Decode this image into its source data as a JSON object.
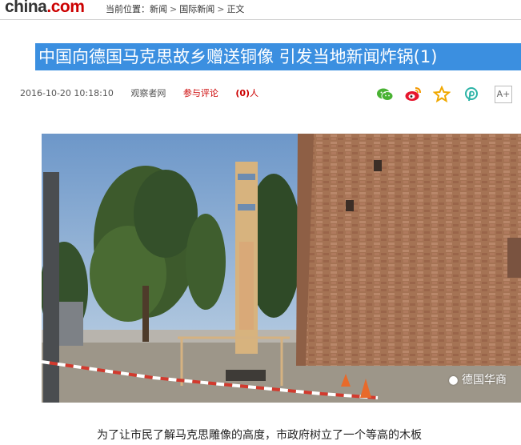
{
  "header": {
    "logo_main": "china",
    "logo_dot": ".",
    "logo_com": "com",
    "breadcrumb": {
      "label": "当前位置：",
      "items": [
        "新闻",
        "国际新闻",
        "正文"
      ]
    }
  },
  "article": {
    "title": "中国向德国马克思故乡赠送铜像 引发当地新闻炸锅(1)",
    "date": "2016-10-20 10:18:10",
    "source": "观察者网",
    "comment_prefix": "参与评论",
    "comment_count": "(0)",
    "comment_suffix": "人",
    "font_button": "A+",
    "image_watermark": "德国华商",
    "caption": "为了让市民了解马克思雕像的高度，市政府树立了一个等高的木板"
  },
  "share_icons": [
    "wechat-icon",
    "weibo-icon",
    "favorite-star-icon",
    "pinterest-icon"
  ],
  "colors": {
    "title_bg": "#3b8fe0",
    "accent_red": "#c00000"
  }
}
